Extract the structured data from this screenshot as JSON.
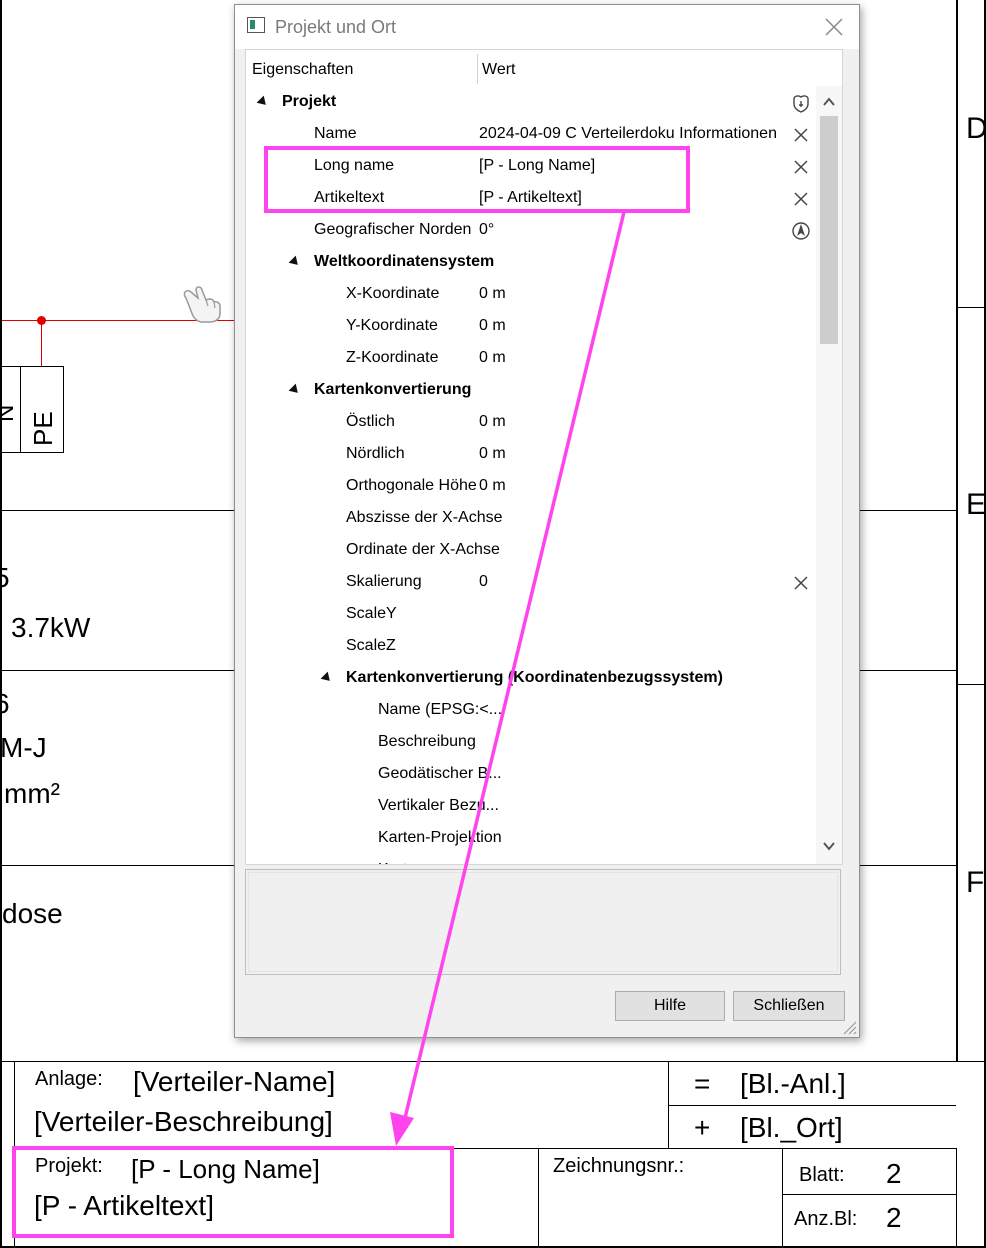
{
  "dialog": {
    "title": "Projekt und Ort",
    "columns": {
      "property": "Eigenschaften",
      "value": "Wert"
    },
    "rows": [
      {
        "label": "Projekt",
        "value": "",
        "bold": true,
        "level": 0,
        "expander": true,
        "icon": "shield-key-icon"
      },
      {
        "label": "Name",
        "value": "2024-04-09 C Verteilerdoku Informationen",
        "level": 1,
        "icon": "clear-x-icon"
      },
      {
        "label": "Long name",
        "value": "[P - Long Name]",
        "level": 1,
        "icon": "clear-x-icon"
      },
      {
        "label": "Artikeltext",
        "value": "[P - Artikeltext]",
        "level": 1,
        "icon": "clear-x-icon"
      },
      {
        "label": "Geografischer Norden",
        "value": "0°",
        "level": 1,
        "icon": "compass-icon"
      },
      {
        "label": "Weltkoordinatensystem",
        "value": "",
        "bold": true,
        "level": 1,
        "expander": true
      },
      {
        "label": "X-Koordinate",
        "value": "0 m",
        "level": 2
      },
      {
        "label": "Y-Koordinate",
        "value": "0 m",
        "level": 2
      },
      {
        "label": "Z-Koordinate",
        "value": "0 m",
        "level": 2
      },
      {
        "label": "Kartenkonvertierung",
        "value": "",
        "bold": true,
        "level": 1,
        "expander": true
      },
      {
        "label": "Östlich",
        "value": "0 m",
        "level": 2
      },
      {
        "label": "Nördlich",
        "value": "0 m",
        "level": 2
      },
      {
        "label": "Orthogonale Höhe",
        "value": "0 m",
        "level": 2
      },
      {
        "label": "Abszisse der X-Achse",
        "value": "",
        "level": 2
      },
      {
        "label": "Ordinate der X-Achse",
        "value": "",
        "level": 2
      },
      {
        "label": "Skalierung",
        "value": "0",
        "level": 2,
        "icon": "clear-x-icon"
      },
      {
        "label": "ScaleY",
        "value": "",
        "level": 2
      },
      {
        "label": "ScaleZ",
        "value": "",
        "level": 2
      },
      {
        "label": "Kartenkonvertierung (Koordinatenbezugssystem)",
        "value": "",
        "bold": true,
        "level": 2,
        "expander": true
      },
      {
        "label": "Name (EPSG:<...",
        "value": "",
        "level": 3
      },
      {
        "label": "Beschreibung",
        "value": "",
        "level": 3
      },
      {
        "label": "Geodätischer B...",
        "value": "",
        "level": 3
      },
      {
        "label": "Vertikaler Bezu...",
        "value": "",
        "level": 3
      },
      {
        "label": "Karten-Projektion",
        "value": "",
        "level": 3
      },
      {
        "label": "Kartenzone",
        "value": "",
        "level": 3
      }
    ],
    "buttons": {
      "help": "Hilfe",
      "close": "Schließen"
    }
  },
  "drawing": {
    "right_letters": {
      "d": "D",
      "e": "E",
      "f": "F"
    },
    "pe_label": "PE",
    "n_label": "N",
    "power_partial": "5",
    "power": "3.7kW",
    "cable_partial": "6",
    "cable_type": "M-J",
    "cable_size": "mm²",
    "dose": "dose"
  },
  "title_block": {
    "anlage_label": "Anlage:",
    "anlage_value": "[Verteiler-Name]",
    "beschreibung": "[Verteiler-Beschreibung]",
    "projekt_label": "Projekt:",
    "projekt_value": "[P - Long Name]",
    "artikeltext": "[P - Artikeltext]",
    "eq_symbol": "=",
    "eq_value": "[Bl.-Anl.]",
    "plus_symbol": "+",
    "plus_value": "[Bl._Ort]",
    "zeichnungsnr_label": "Zeichnungsnr.:",
    "blatt_label": "Blatt:",
    "blatt_value": "2",
    "anzbl_label": "Anz.Bl:",
    "anzbl_value": "2"
  },
  "colors": {
    "highlight": "#ff44ee",
    "wire": "#e00000"
  }
}
